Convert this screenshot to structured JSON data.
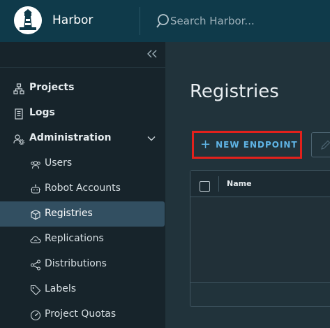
{
  "header": {
    "app_title": "Harbor",
    "logo_icon": "lighthouse-icon",
    "search": {
      "placeholder": "Search Harbor..."
    }
  },
  "sidebar": {
    "collapse_icon": "double-chevron-left-icon",
    "items": [
      {
        "label": "Projects",
        "icon": "projects-icon"
      },
      {
        "label": "Logs",
        "icon": "logs-icon"
      },
      {
        "label": "Administration",
        "icon": "administration-icon",
        "expanded": true
      }
    ],
    "admin_items": [
      {
        "label": "Users",
        "icon": "users-icon"
      },
      {
        "label": "Robot Accounts",
        "icon": "robot-icon"
      },
      {
        "label": "Registries",
        "icon": "cube-icon",
        "active": true
      },
      {
        "label": "Replications",
        "icon": "cloud-icon"
      },
      {
        "label": "Distributions",
        "icon": "share-icon"
      },
      {
        "label": "Labels",
        "icon": "tag-icon"
      },
      {
        "label": "Project Quotas",
        "icon": "gauge-icon"
      }
    ]
  },
  "main": {
    "title": "Registries",
    "new_endpoint_label": "NEW ENDPOINT",
    "table": {
      "columns": [
        "Name"
      ]
    }
  },
  "colors": {
    "header_bg": "#0f3a4a",
    "sidebar_bg": "#17242b",
    "active_item_bg": "#324f61",
    "main_bg": "#21333b",
    "accent": "#5fb4e5",
    "highlight_border": "#e2211c"
  }
}
